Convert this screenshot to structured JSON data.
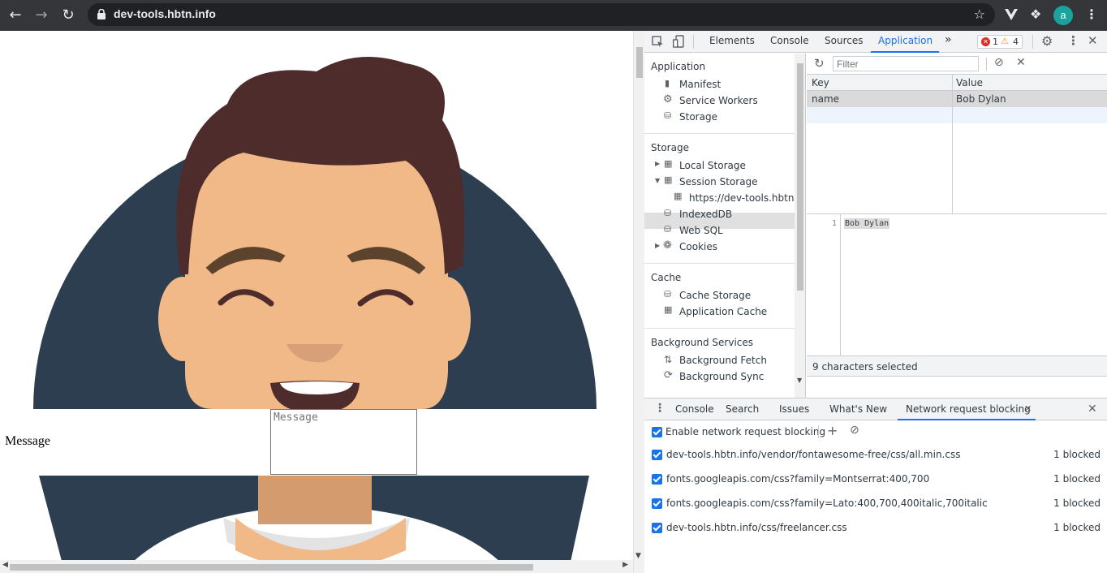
{
  "browser": {
    "url": "dev-tools.hbtn.info",
    "avatar_letter": "a"
  },
  "page": {
    "message_label": "Message",
    "message_placeholder": "Message"
  },
  "devtools": {
    "tabs": [
      "Elements",
      "Console",
      "Sources",
      "Application"
    ],
    "active_tab": "Application",
    "error_count": "1",
    "warning_count": "4",
    "sidebar": {
      "application": {
        "title": "Application",
        "items": [
          "Manifest",
          "Service Workers",
          "Storage"
        ]
      },
      "storage": {
        "title": "Storage",
        "items": [
          "Local Storage",
          "Session Storage",
          "https://dev-tools.hbtn.in",
          "IndexedDB",
          "Web SQL",
          "Cookies"
        ]
      },
      "cache": {
        "title": "Cache",
        "items": [
          "Cache Storage",
          "Application Cache"
        ]
      },
      "background": {
        "title": "Background Services",
        "items": [
          "Background Fetch",
          "Background Sync"
        ]
      }
    },
    "storage_view": {
      "filter_placeholder": "Filter",
      "columns": [
        "Key",
        "Value"
      ],
      "rows": [
        {
          "key": "name",
          "value": "Bob Dylan"
        }
      ],
      "editor_line_number": "1",
      "editor_text": "Bob Dylan",
      "status": "9 characters selected"
    },
    "drawer": {
      "tabs": [
        "Console",
        "Search",
        "Issues",
        "What's New",
        "Network request blocking"
      ],
      "active_tab": "Network request blocking",
      "enable_label": "Enable network request blocking",
      "rules": [
        {
          "pattern": "dev-tools.hbtn.info/vendor/fontawesome-free/css/all.min.css",
          "count": "1 blocked"
        },
        {
          "pattern": "fonts.googleapis.com/css?family=Montserrat:400,700",
          "count": "1 blocked"
        },
        {
          "pattern": "fonts.googleapis.com/css?family=Lato:400,700,400italic,700italic",
          "count": "1 blocked"
        },
        {
          "pattern": "dev-tools.hbtn.info/css/freelancer.css",
          "count": "1 blocked"
        }
      ]
    }
  },
  "colors": {
    "accent": "#1a73e8",
    "chrome_bar": "#35363a",
    "avatar_bg_circle": "#2c3e50",
    "hair": "#4e2c2b",
    "skin": "#f1b888"
  }
}
